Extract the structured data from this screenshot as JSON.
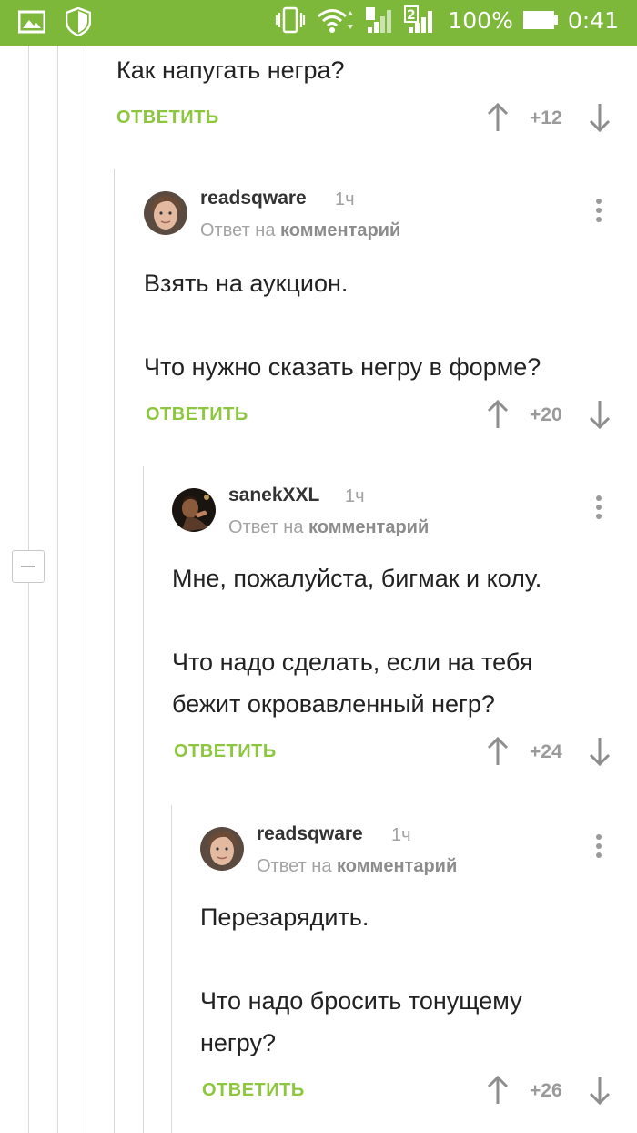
{
  "status_bar": {
    "battery": "100%",
    "time": "0:41",
    "sim2": "2"
  },
  "top_comment": {
    "text": "Как напугать негра?",
    "reply_label": "ОТВЕТИТЬ",
    "score": "+12"
  },
  "comments": [
    {
      "author": "readsqware",
      "time": "1ч",
      "reply_prefix": "Ответ на",
      "reply_link": "комментарий",
      "lines": [
        "Взять на аукцион.",
        "",
        "Что нужно сказать негру в форме?"
      ],
      "reply_label": "ОТВЕТИТЬ",
      "score": "+20"
    },
    {
      "author": "sanekXXL",
      "time": "1ч",
      "reply_prefix": "Ответ на",
      "reply_link": "комментарий",
      "lines": [
        "Мне, пожалуйста, бигмак и колу.",
        "",
        "Что надо сделать, если на тебя",
        "бежит окровавленный негр?"
      ],
      "reply_label": "ОТВЕТИТЬ",
      "score": "+24"
    },
    {
      "author": "readsqware",
      "time": "1ч",
      "reply_prefix": "Ответ на",
      "reply_link": "комментарий",
      "lines": [
        "Перезарядить.",
        "",
        "Что надо бросить тонущему",
        "негру?"
      ],
      "reply_label": "ОТВЕТИТЬ",
      "score": "+26"
    }
  ],
  "colors": {
    "status_bar": "#7eb83b",
    "reply_green": "#8dc63f"
  }
}
